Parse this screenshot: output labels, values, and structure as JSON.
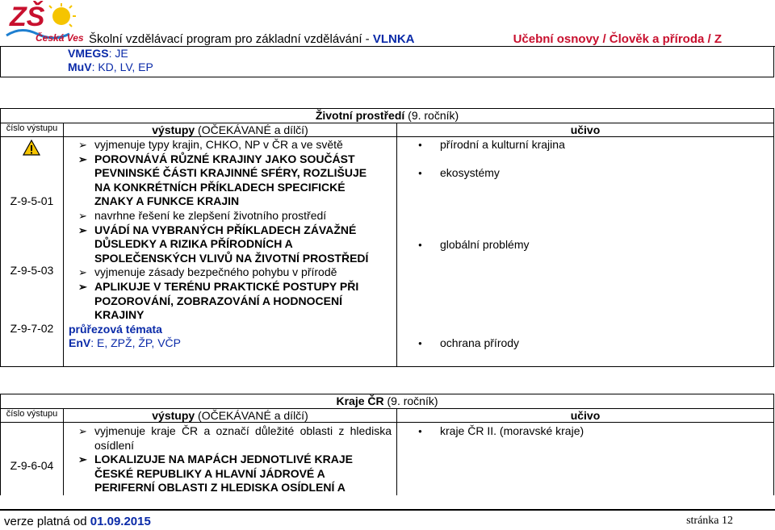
{
  "header": {
    "logo_main": "ZŠ",
    "logo_sub": "Česká Ves",
    "program_prefix": "Školní vzdělávací program pro základní vzdělávání - ",
    "program_name": "VLNKA",
    "subject_prefix": "Učební osnovy / ",
    "subject": "Člověk a příroda / Z"
  },
  "top_box": {
    "line1_label": "VMEGS",
    "line1_value": ": JE",
    "line2_label": "MuV",
    "line2_value": ": KD, LV, EP"
  },
  "table1": {
    "title": "Životní prostředí",
    "title_suffix": " (9. ročník)",
    "col_code": "číslo výstupu",
    "col_outputs_b": "výstupy",
    "col_outputs_rest": " (OČEKÁVANÉ a dílčí)",
    "col_content": "učivo",
    "codes": [
      "Z-9-5-01",
      "Z-9-5-03",
      "Z-9-7-02"
    ],
    "outputs": [
      "vyjmenuje typy krajin, CHKO, NP v ČR a ve světě",
      "POROVNÁVÁ RŮZNÉ KRAJINY JAKO SOUČÁST PEVNINSKÉ ČÁSTI KRAJINNÉ SFÉRY, ROZLIŠUJE NA KONKRÉTNÍCH PŘÍKLADECH SPECIFICKÉ ZNAKY A FUNKCE KRAJIN",
      "navrhne řešení ke zlepšení životního prostředí",
      "UVÁDÍ NA VYBRANÝCH PŘÍKLADECH ZÁVAŽNÉ DŮSLEDKY A RIZIKA PŘÍRODNÍCH A SPOLEČENSKÝCH VLIVŮ NA ŽIVOTNÍ PROSTŘEDÍ",
      "vyjmenuje zásady bezpečného pohybu v přírodě",
      "APLIKUJE V TERÉNU PRAKTICKÉ POSTUPY PŘI POZOROVÁNÍ, ZOBRAZOVÁNÍ A HODNOCENÍ KRAJINY"
    ],
    "themes_label": "průřezová témata",
    "themes_value_label": "EnV",
    "themes_value": ": E, ZPŽ, ŽP, VČP",
    "content": [
      "přírodní a kulturní krajina",
      "ekosystémy",
      "globální problémy",
      "ochrana přírody"
    ]
  },
  "table2": {
    "title": "Kraje ČR",
    "title_suffix": " (9. ročník)",
    "col_code": "číslo výstupu",
    "col_outputs_b": "výstupy",
    "col_outputs_rest": " (OČEKÁVANÉ a dílčí)",
    "col_content": "učivo",
    "code": "Z-9-6-04",
    "outputs": [
      "vyjmenuje kraje ČR a označí důležité oblasti z hlediska osídlení",
      "LOKALIZUJE NA MAPÁCH JEDNOTLIVÉ KRAJE ČESKÉ REPUBLIKY A HLAVNÍ JÁDROVÉ A PERIFERNÍ OBLASTI Z HLEDISKA OSÍDLENÍ A"
    ],
    "content": [
      "kraje ČR II. (moravské kraje)"
    ]
  },
  "footer": {
    "version_prefix": "verze platná od ",
    "version_date": "01.09.2015",
    "page": "stránka 12"
  },
  "colors": {
    "accent_blue": "#0a2aa8",
    "accent_red": "#c8102e",
    "warning": "#f5c400"
  }
}
